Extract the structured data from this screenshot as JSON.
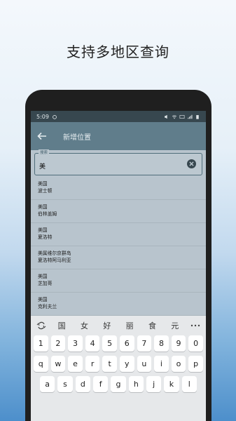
{
  "promo": {
    "title": "支持多地区查询"
  },
  "statusbar": {
    "time": "5:09"
  },
  "appbar": {
    "title": "新增位置"
  },
  "search": {
    "label": "搜索",
    "value": "美"
  },
  "results": [
    {
      "line1": "美国",
      "line2": "波士顿"
    },
    {
      "line1": "美国",
      "line2": "伯林盖姆"
    },
    {
      "line1": "美国",
      "line2": "夏洛特"
    },
    {
      "line1": "美属维尔京群岛",
      "line2": "夏洛特阿马利亚"
    },
    {
      "line1": "美国",
      "line2": "芝加哥"
    },
    {
      "line1": "美国",
      "line2": "克利夫兰"
    }
  ],
  "keyboard": {
    "candidates": [
      "国",
      "女",
      "好",
      "丽",
      "食",
      "元"
    ],
    "numbers": [
      "1",
      "2",
      "3",
      "4",
      "5",
      "6",
      "7",
      "8",
      "9",
      "0"
    ],
    "row1": [
      "q",
      "w",
      "e",
      "r",
      "t",
      "y",
      "u",
      "i",
      "o",
      "p"
    ],
    "row2": [
      "a",
      "s",
      "d",
      "f",
      "g",
      "h",
      "j",
      "k",
      "l"
    ]
  },
  "colors": {
    "appbar": "#607d8b",
    "statusbar": "#37474f",
    "screen": "#b8c4cd"
  }
}
